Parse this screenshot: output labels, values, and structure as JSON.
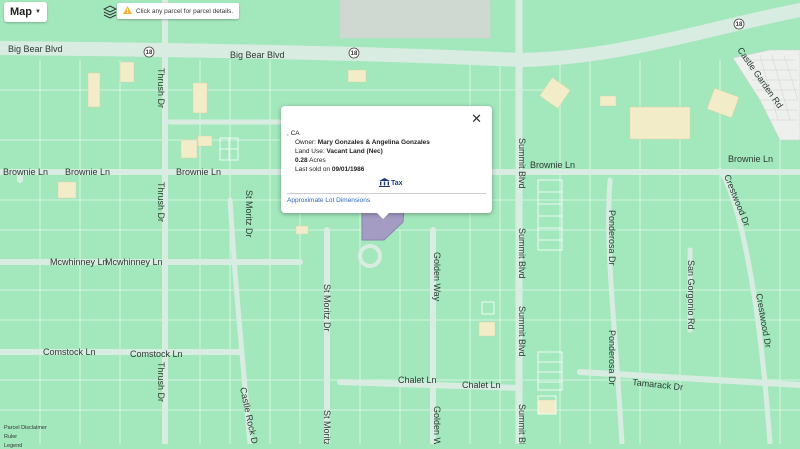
{
  "toolbar": {
    "map_label": "Map",
    "layers_icon": "layers-icon",
    "locate_icon": "locate-icon",
    "hint_icon": "warning-icon",
    "hint_text": "Click any parcel for parcel details."
  },
  "streets": {
    "big_bear_1": "Big Bear Blvd",
    "big_bear_2": "Big Bear Blvd",
    "route": "18",
    "brownie_1": "Brownie Ln",
    "brownie_2": "Brownie Ln",
    "brownie_3": "Brownie Ln",
    "brownie_4": "Brownie Ln",
    "brownie_5": "Brownie Ln",
    "mcwhinney_1": "Mcwhinney Ln",
    "mcwhinney_2": "Mcwhinney Ln",
    "comstock_1": "Comstock Ln",
    "comstock_2": "Comstock Ln",
    "chalet_1": "Chalet Ln",
    "chalet_2": "Chalet Ln",
    "tamarack": "Tamarack Dr",
    "thrush": "Thrush Dr",
    "thrush_2": "Thrush Dr",
    "st_moritz": "St Moritz Dr",
    "st_moritz_2": "St Moritz Dr",
    "golden_1": "Golden Way",
    "golden_2": "Golden Way",
    "summit_1": "Summit Blvd",
    "summit_2": "Summit Blvd",
    "ponderosa_1": "Ponderosa Dr",
    "ponderosa_2": "Ponderosa Dr",
    "san_gorgonio": "San Gorgonio Rd",
    "crestwood_1": "Crestwood Dr",
    "crestwood_2": "Crestwood Dr",
    "castle_rock": "Castle Rock Dr",
    "st_moritz_small": "St Moritz Dr",
    "castle_garden": "Castle Garden Rd"
  },
  "popup": {
    "close_icon": "close-icon",
    "address": ", CA",
    "owner_label": "Owner:",
    "owner": "Mary Gonzales & Angelina Gonzales",
    "land_use_label": "Land Use:",
    "land_use": "Vacant Land (Nec)",
    "acres": "0.28",
    "acres_label": "Acres",
    "last_sold_label": "Last sold on",
    "last_sold_date": "09/01/1986",
    "tax_label": "Tax",
    "lot_link": "Approximate Lot Dimensions"
  },
  "footer": {
    "disclaimer": "Parcel Disclaimer",
    "ruler": "Ruler",
    "legend": "Legend"
  },
  "colors": {
    "map_bg": "#a3e8bd",
    "road": "#d9ece2",
    "building": "#f2edc8",
    "parcel_highlight": "#a59cc4",
    "link": "#2a66b8"
  }
}
